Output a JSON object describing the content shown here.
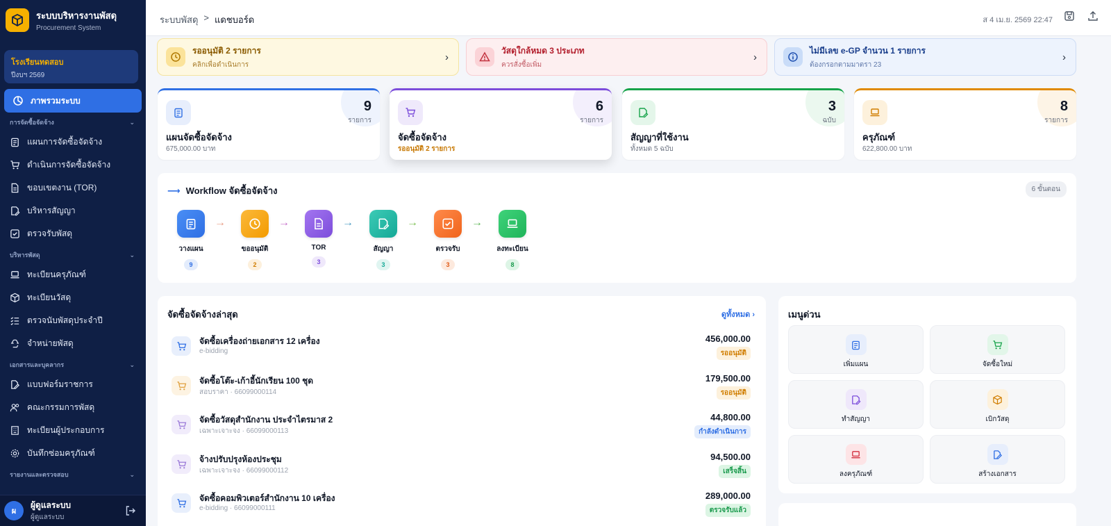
{
  "sidebar": {
    "brand_title": "ระบบบริหารงานพัสดุ",
    "brand_subtitle": "Procurement System",
    "org_name": "โรงเรียนทดสอบ",
    "org_year": "ปีงบฯ 2569",
    "active_item": "ภาพรวมระบบ",
    "sections": [
      {
        "title": "การจัดซื้อจัดจ้าง",
        "items": [
          "แผนการจัดซื้อจัดจ้าง",
          "ดำเนินการจัดซื้อจัดจ้าง",
          "ขอบเขตงาน (TOR)",
          "บริหารสัญญา",
          "ตรวจรับพัสดุ"
        ]
      },
      {
        "title": "บริหารพัสดุ",
        "items": [
          "ทะเบียนครุภัณฑ์",
          "ทะเบียนวัสดุ",
          "ตรวจนับพัสดุประจำปี",
          "จำหน่ายพัสดุ"
        ]
      },
      {
        "title": "เอกสารและบุคลากร",
        "items": [
          "แบบฟอร์มราชการ",
          "คณะกรรมการพัสดุ",
          "ทะเบียนผู้ประกอบการ",
          "บันทึกซ่อมครุภัณฑ์"
        ]
      },
      {
        "title": "รายงานและตรวจสอบ",
        "items": []
      }
    ],
    "user_initial": "ผ",
    "user_name": "ผู้ดูแลระบบ",
    "user_role": "ผู้ดูแลระบบ"
  },
  "topbar": {
    "crumb_root": "ระบบพัสดุ",
    "crumb_sep": ">",
    "crumb_current": "แดชบอร์ด",
    "datetime": "ส 4 เม.ย. 2569 22:47"
  },
  "alerts": [
    {
      "title": "รออนุมัติ 2 รายการ",
      "subtitle": "คลิกเพื่อดำเนินการ",
      "icon": "clock-icon"
    },
    {
      "title": "วัสดุใกล้หมด 3 ประเภท",
      "subtitle": "ควรสั่งซื้อเพิ่ม",
      "icon": "warning-icon"
    },
    {
      "title": "ไม่มีเลข e-GP จำนวน 1 รายการ",
      "subtitle": "ต้องกรอกตามมาตรา 23",
      "icon": "info-icon"
    }
  ],
  "stats": [
    {
      "value": "9",
      "unit": "รายการ",
      "label": "แผนจัดซื้อจัดจ้าง",
      "sub": "675,000.00 บาท",
      "color": "#2f6fe4"
    },
    {
      "value": "6",
      "unit": "รายการ",
      "label": "จัดซื้อจัดจ้าง",
      "sub": "รออนุมัติ 2 รายการ",
      "color": "#7c4ddb"
    },
    {
      "value": "3",
      "unit": "ฉบับ",
      "label": "สัญญาที่ใช้งาน",
      "sub": "ทั้งหมด 5 ฉบับ",
      "color": "#16a34a"
    },
    {
      "value": "8",
      "unit": "รายการ",
      "label": "ครุภัณฑ์",
      "sub": "622,800.00 บาท",
      "color": "#e08a00"
    }
  ],
  "workflow": {
    "title": "Workflow จัดซื้อจัดจ้าง",
    "badge": "6 ขั้นตอน",
    "steps": [
      {
        "name": "วางแผน",
        "count": "9"
      },
      {
        "name": "ขออนุมัติ",
        "count": "2"
      },
      {
        "name": "TOR",
        "count": "3"
      },
      {
        "name": "สัญญา",
        "count": "3"
      },
      {
        "name": "ตรวจรับ",
        "count": "3"
      },
      {
        "name": "ลงทะเบียน",
        "count": "8"
      }
    ]
  },
  "recent": {
    "title": "จัดซื้อจัดจ้างล่าสุด",
    "view_all": "ดูทั้งหมด",
    "rows": [
      {
        "name": "จัดซื้อเครื่องถ่ายเอกสาร 12 เครื่อง",
        "meta": "e-bidding",
        "amount": "456,000.00",
        "status": "รออนุมัติ"
      },
      {
        "name": "จัดซื้อโต๊ะ-เก้าอี้นักเรียน 100 ชุด",
        "meta": "สอบราคา · 66099000114",
        "amount": "179,500.00",
        "status": "รออนุมัติ"
      },
      {
        "name": "จัดซื้อวัสดุสำนักงาน ประจำไตรมาส 2",
        "meta": "เฉพาะเจาะจง · 66099000113",
        "amount": "44,800.00",
        "status": "กำลังดำเนินการ"
      },
      {
        "name": "จ้างปรับปรุงห้องประชุม",
        "meta": "เฉพาะเจาะจง · 66099000112",
        "amount": "94,500.00",
        "status": "เสร็จสิ้น"
      },
      {
        "name": "จัดซื้อคอมพิวเตอร์สำนักงาน 10 เครื่อง",
        "meta": "e-bidding · 66099000111",
        "amount": "289,000.00",
        "status": "ตรวจรับแล้ว"
      }
    ]
  },
  "quick": {
    "title": "เมนูด่วน",
    "items": [
      {
        "name": "เพิ่มแผน",
        "icon": "clipboard-icon"
      },
      {
        "name": "จัดซื้อใหม่",
        "icon": "cart-icon"
      },
      {
        "name": "ทำสัญญา",
        "icon": "contract-icon"
      },
      {
        "name": "เบิกวัสดุ",
        "icon": "box-icon"
      },
      {
        "name": "ลงครุภัณฑ์",
        "icon": "laptop-icon"
      },
      {
        "name": "สร้างเอกสาร",
        "icon": "edit-doc-icon"
      }
    ]
  }
}
